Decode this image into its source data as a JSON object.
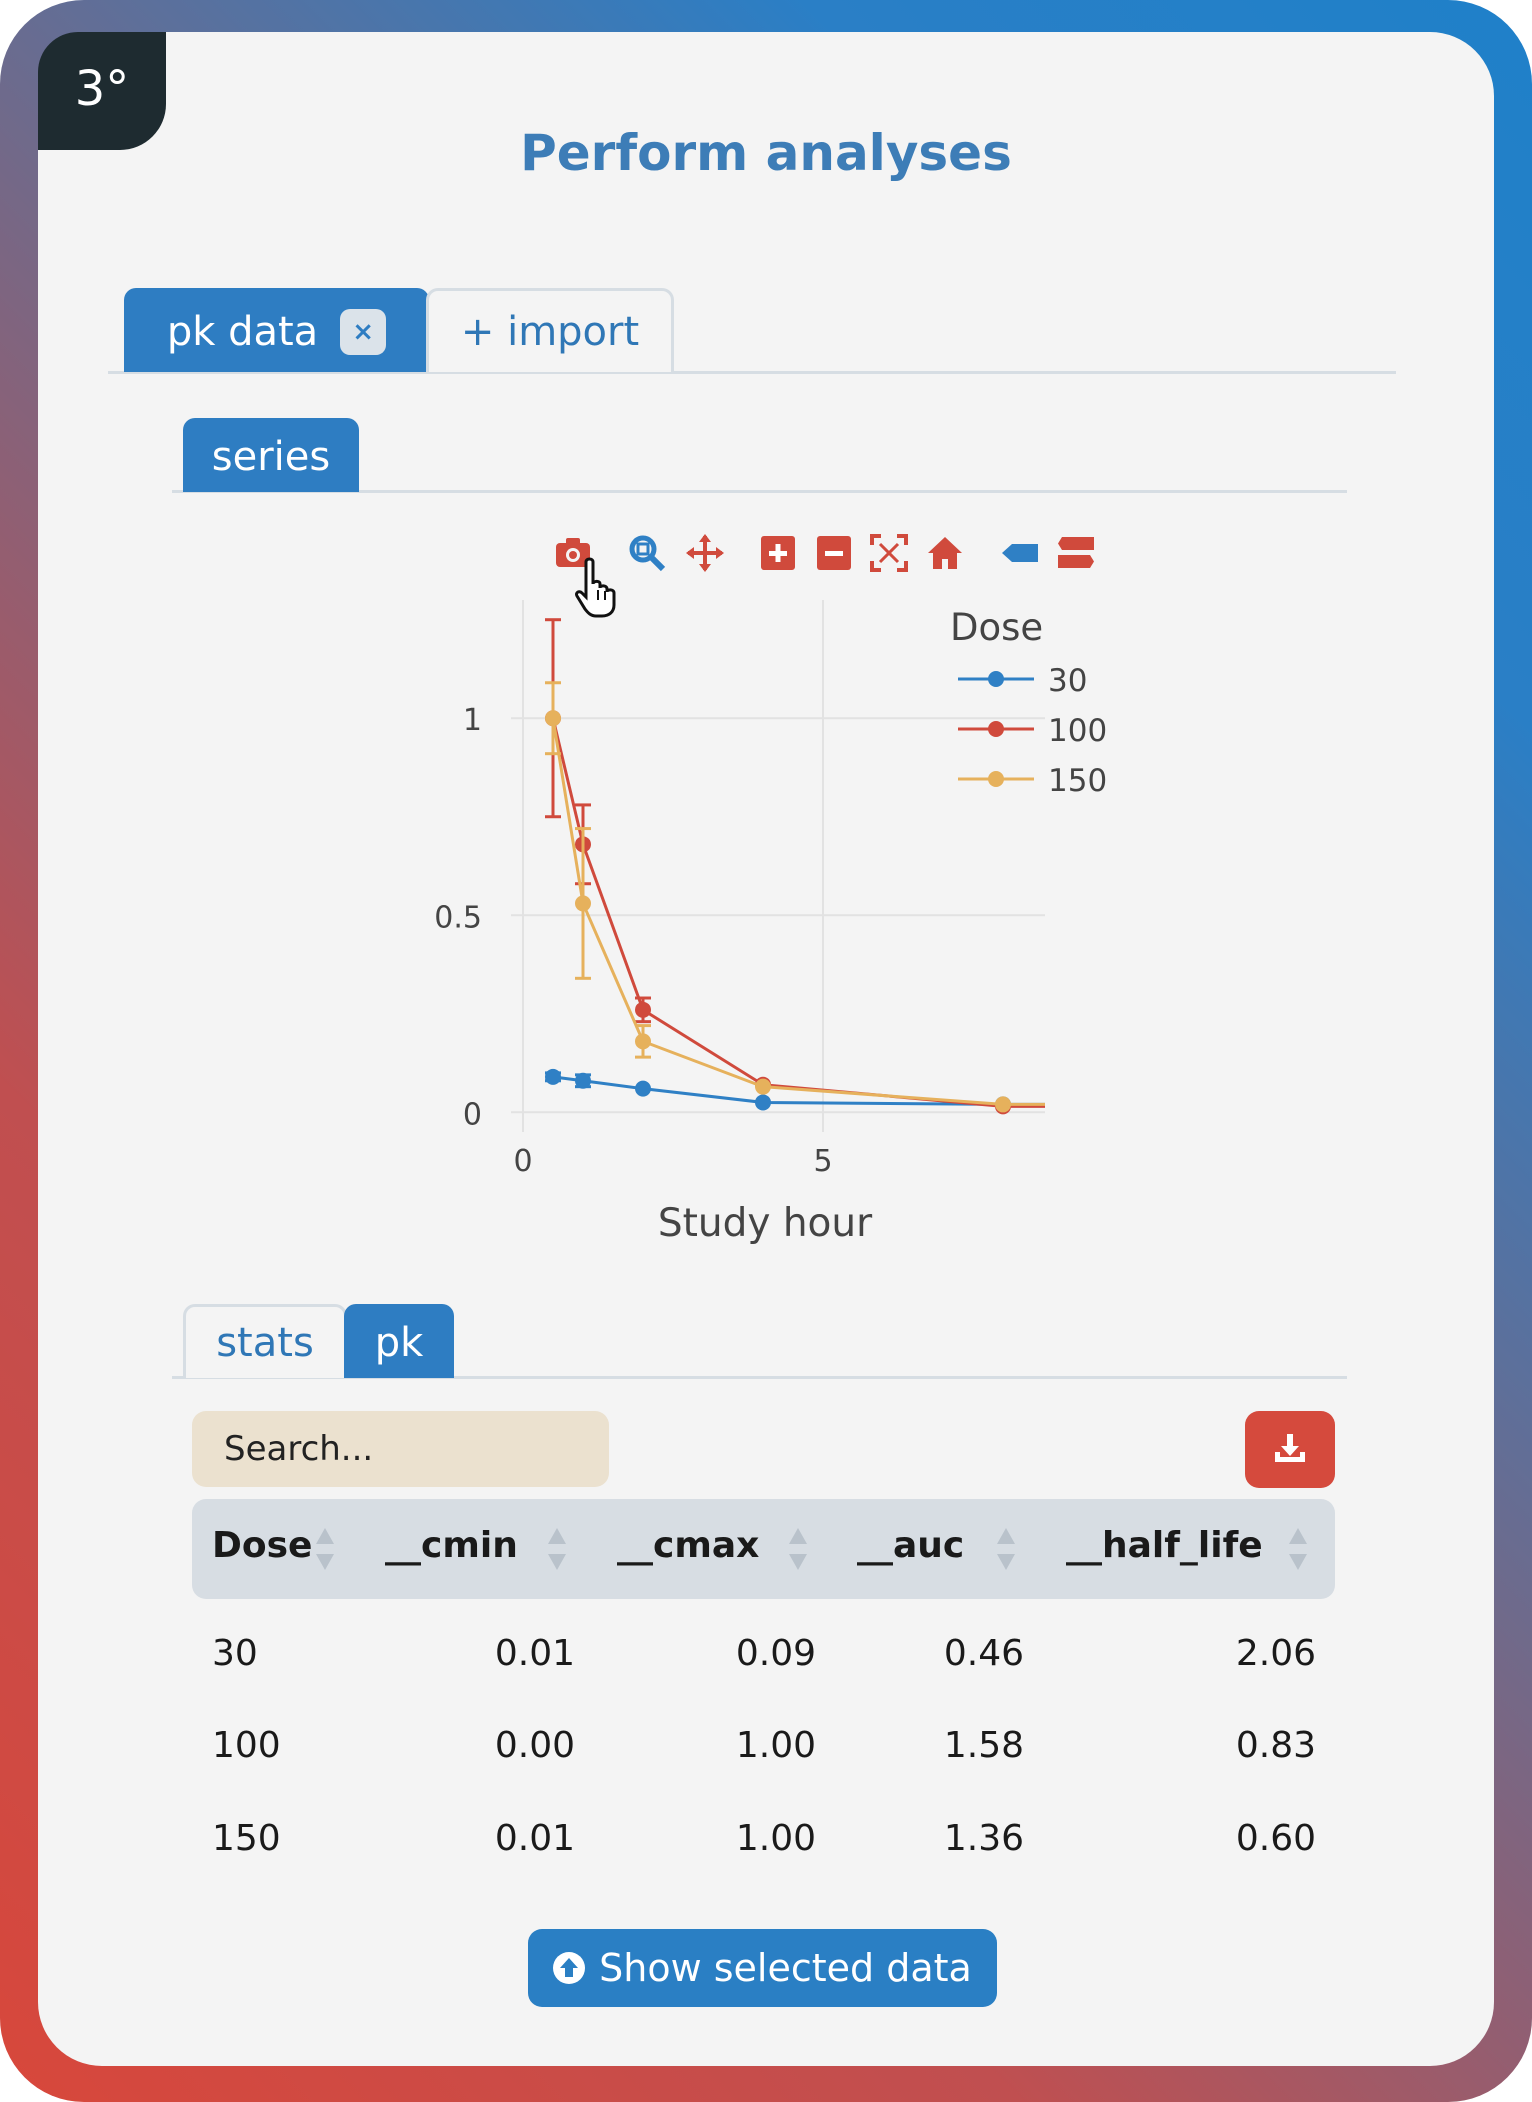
{
  "badge": "3°",
  "title": "Perform analyses",
  "top_tabs": [
    {
      "label": "pk data",
      "close": "×"
    },
    {
      "label": "+ import"
    }
  ],
  "sub_tabs": [
    {
      "label": "series"
    }
  ],
  "modebar_icons": [
    "camera-icon",
    "zoom-icon",
    "pan-icon",
    "zoom-in-icon",
    "zoom-out-icon",
    "autoscale-icon",
    "reset-axes-icon",
    "hover-closest-icon",
    "hover-compare-icon"
  ],
  "colors": {
    "blue": "#2f80c5",
    "red": "#d04a3c",
    "yellow": "#e6b15c",
    "accent": "#2e7dc2"
  },
  "chart_data": {
    "type": "line",
    "xlabel": "Study hour",
    "ylabel": "",
    "xlim": [
      -0.2,
      8.7
    ],
    "ylim": [
      -0.05,
      1.3
    ],
    "xticks": [
      0,
      5
    ],
    "yticks": [
      0,
      0.5,
      1
    ],
    "legend_title": "Dose",
    "legend_position": "top-right",
    "series": [
      {
        "name": "30",
        "color": "#2f80c5",
        "x": [
          0.5,
          1,
          2,
          4,
          8,
          8.7
        ],
        "y": [
          0.09,
          0.08,
          0.06,
          0.025,
          0.02,
          0.02
        ],
        "err": [
          0.01,
          0.015,
          0,
          0,
          0,
          0
        ]
      },
      {
        "name": "100",
        "color": "#d04a3c",
        "x": [
          0.5,
          1,
          2,
          4,
          8,
          8.7
        ],
        "y": [
          1.0,
          0.68,
          0.26,
          0.07,
          0.015,
          0.015
        ],
        "err": [
          0.25,
          0.1,
          0.03,
          0,
          0,
          0
        ]
      },
      {
        "name": "150",
        "color": "#e6b15c",
        "x": [
          0.5,
          1,
          2,
          4,
          8,
          8.7
        ],
        "y": [
          1.0,
          0.53,
          0.18,
          0.065,
          0.02,
          0.02
        ],
        "err": [
          0.09,
          0.19,
          0.04,
          0,
          0,
          0
        ]
      }
    ]
  },
  "bottom_tabs": [
    {
      "label": "stats"
    },
    {
      "label": "pk"
    }
  ],
  "search": {
    "placeholder": "Search..."
  },
  "table": {
    "columns": [
      "Dose",
      "__cmin",
      "__cmax",
      "__auc",
      "__half_life"
    ],
    "rows": [
      [
        "30",
        "0.01",
        "0.09",
        "0.46",
        "2.06"
      ],
      [
        "100",
        "0.00",
        "1.00",
        "1.58",
        "0.83"
      ],
      [
        "150",
        "0.01",
        "1.00",
        "1.36",
        "0.60"
      ]
    ]
  },
  "show_button": "Show selected data"
}
